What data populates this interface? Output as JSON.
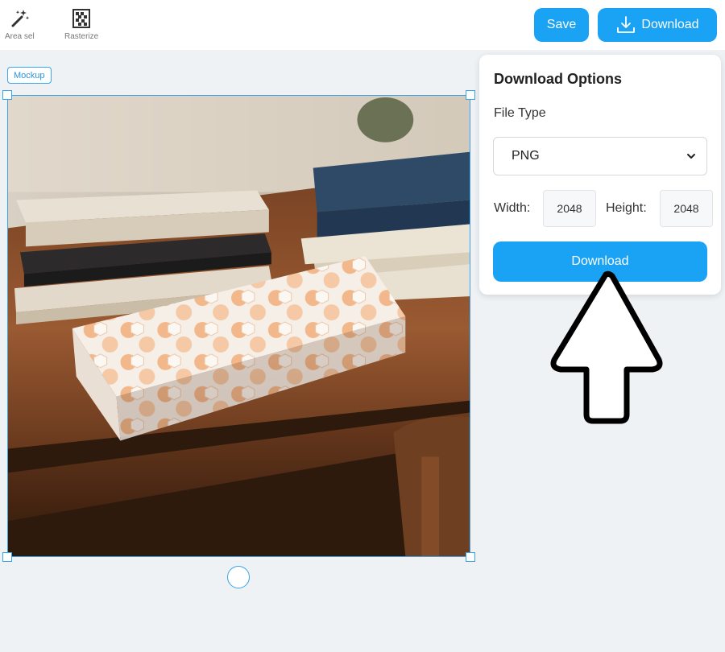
{
  "toolbar": {
    "area_sel_label": "Area sel",
    "rasterize_label": "Rasterize",
    "save_label": "Save",
    "download_label": "Download"
  },
  "canvas": {
    "tag_label": "Mockup"
  },
  "download_panel": {
    "title": "Download Options",
    "file_type_label": "File Type",
    "file_type_value": "PNG",
    "width_label": "Width:",
    "width_value": "2048",
    "height_label": "Height:",
    "height_value": "2048",
    "download_label": "Download"
  },
  "colors": {
    "accent": "#1aa3f5",
    "selection": "#3aa2e6",
    "canvas_bg": "#eef2f5"
  },
  "icons": {
    "area_sel": "magic-wand-icon",
    "rasterize": "grid-icon",
    "download": "download-tray-icon",
    "select": "chevron-down-icon",
    "cursor": "arrow-cursor-icon"
  }
}
